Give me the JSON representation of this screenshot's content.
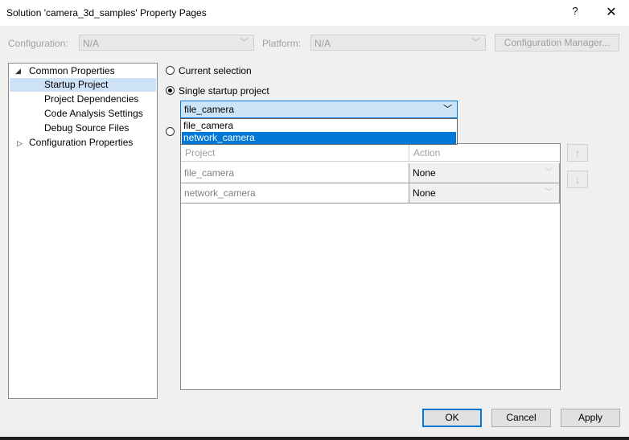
{
  "window": {
    "title": "Solution 'camera_3d_samples' Property Pages",
    "help_glyph": "?",
    "close_glyph": "✕"
  },
  "config_bar": {
    "configuration_label": "Configuration:",
    "configuration_value": "N/A",
    "platform_label": "Platform:",
    "platform_value": "N/A",
    "manager_button": "Configuration Manager..."
  },
  "tree": {
    "items": [
      {
        "label": "Common Properties",
        "expanded": true,
        "glyph": "◢"
      },
      {
        "label": "Startup Project",
        "selected": true
      },
      {
        "label": "Project Dependencies"
      },
      {
        "label": "Code Analysis Settings"
      },
      {
        "label": "Debug Source Files"
      },
      {
        "label": "Configuration Properties",
        "expanded": false,
        "glyph": "▷"
      }
    ]
  },
  "options": {
    "current_selection": "Current selection",
    "single_startup": "Single startup project",
    "selected_option": "single_startup",
    "startup_value": "file_camera",
    "dropdown_items": [
      "file_camera",
      "network_camera"
    ],
    "highlighted_item": "network_camera"
  },
  "grid": {
    "headers": [
      "Project",
      "Action"
    ],
    "rows": [
      {
        "project": "file_camera",
        "action": "None"
      },
      {
        "project": "network_camera",
        "action": "None"
      }
    ],
    "move_up_glyph": "↑",
    "move_down_glyph": "↓"
  },
  "buttons": {
    "ok": "OK",
    "cancel": "Cancel",
    "apply": "Apply"
  },
  "colors": {
    "accent": "#0078d7",
    "selection": "#cde1f7"
  }
}
